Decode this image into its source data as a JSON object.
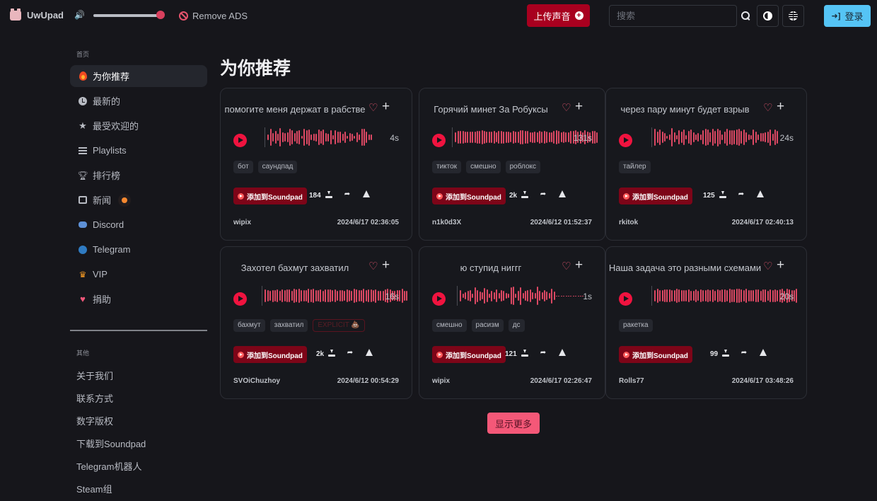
{
  "header": {
    "app_name": "UwUpad",
    "volume_percent": 92,
    "remove_ads_label": "Remove ADS",
    "upload_label": "上传声音",
    "search_placeholder": "搜索",
    "login_label": "登录",
    "colors": {
      "upload_bg": "#a8001f",
      "login_bg": "#55c4f5",
      "accent": "#f0133f"
    }
  },
  "sidebar": {
    "section_home": "首页",
    "items": [
      {
        "label": "为你推荐",
        "icon": "fire-icon",
        "active": true
      },
      {
        "label": "最新的",
        "icon": "clock-icon"
      },
      {
        "label": "最受欢迎的",
        "icon": "star-icon"
      },
      {
        "label": "Playlists",
        "icon": "list-icon"
      },
      {
        "label": "排行榜",
        "icon": "trophy-icon"
      },
      {
        "label": "新闻",
        "icon": "newspaper-icon",
        "badge": "dot"
      },
      {
        "label": "Discord",
        "icon": "discord-icon"
      },
      {
        "label": "Telegram",
        "icon": "telegram-icon"
      },
      {
        "label": "VIP",
        "icon": "crown-icon"
      },
      {
        "label": "捐助",
        "icon": "heart-icon"
      }
    ],
    "section_other": "其他",
    "other_links": [
      "关于我们",
      "联系方式",
      "数字版权",
      "下载到Soundpad",
      "Telegram机器人",
      "Steam组"
    ]
  },
  "main": {
    "title": "为你推荐",
    "add_label": "添加到Soundpad",
    "show_more_label": "显示更多",
    "cards": [
      {
        "title": "помогите меня держат в рабстве",
        "duration": "4s",
        "tags": [
          "бот",
          "саундпад"
        ],
        "downloads": "184",
        "author": "wipix",
        "date": "2024/6/17 02:36:05"
      },
      {
        "title": "Горячий минет За Робуксы",
        "duration": "131s",
        "tags": [
          "тикток",
          "смешно",
          "роблокс"
        ],
        "downloads": "2k",
        "author": "n1k0d3X",
        "date": "2024/6/12 01:52:37"
      },
      {
        "title": "через пару минут будет взрыв",
        "duration": "24s",
        "tags": [
          "тайлер"
        ],
        "downloads": "125",
        "author": "rkitok",
        "date": "2024/6/17 02:40:13"
      },
      {
        "title": "Захотел бахмут захватил",
        "duration": "16s",
        "tags": [
          "бахмут",
          "захватил"
        ],
        "explicit_tag": "EXPLICIT 💩",
        "downloads": "2k",
        "author": "SVOiChuzhoy",
        "date": "2024/6/12 00:54:29"
      },
      {
        "title": "ю ступид ниггг",
        "duration": "1s",
        "tags": [
          "смешно",
          "расизм",
          "дс"
        ],
        "downloads": "121",
        "author": "wipix",
        "date": "2024/6/17 02:26:47"
      },
      {
        "title": "Наша задача это разными схемами",
        "duration": "20s",
        "tags": [
          "ракетка"
        ],
        "downloads": "99",
        "author": "Rolls77",
        "date": "2024/6/17 03:48:26"
      }
    ]
  }
}
